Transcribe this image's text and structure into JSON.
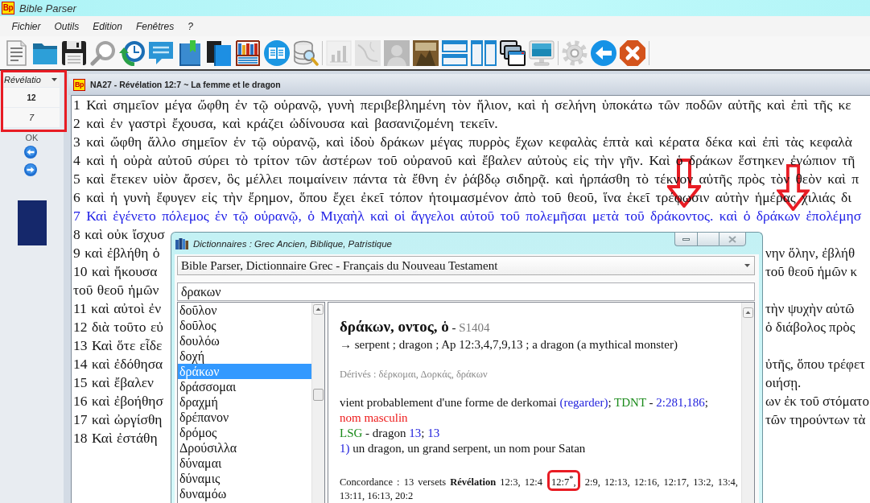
{
  "app": {
    "logo": "Bp",
    "title": "Bible Parser"
  },
  "menu": [
    "Fichier",
    "Outils",
    "Edition",
    "Fenêtres",
    "?"
  ],
  "toolbar": {
    "groups": [
      [
        {
          "disabled": false
        },
        {
          "disabled": false
        },
        {
          "disabled": false
        },
        {
          "disabled": false
        },
        {
          "disabled": false
        },
        {
          "disabled": false
        },
        {
          "disabled": false
        },
        {
          "disabled": false
        },
        {
          "disabled": false
        },
        {
          "disabled": false
        },
        {
          "disabled": false
        }
      ],
      [
        {
          "disabled": true
        },
        {
          "disabled": true
        },
        {
          "disabled": true
        },
        {
          "disabled": false
        },
        {
          "disabled": false
        },
        {
          "disabled": false
        },
        {
          "disabled": false
        },
        {
          "disabled": false
        }
      ],
      [
        {
          "disabled": false
        },
        {
          "disabled": false
        },
        {
          "disabled": false
        }
      ]
    ]
  },
  "navigator": {
    "book": "Révélatio",
    "chapter": "12",
    "verse": "7",
    "button": "OK"
  },
  "document": {
    "logo": "Bp",
    "title": "NA27 - Révélation 12:7 ~ La femme et le dragon",
    "lines": [
      {
        "kind": "full",
        "number": "1",
        "text": "Καὶ σημεῖον μέγα ὤφθη ἐν τῷ οὐρανῷ, γυνὴ περιβεβλημένη τὸν ἥλιον, καὶ ἡ σελήνη ὑποκάτω τῶν ποδῶν αὐτῆς καὶ ἐπὶ τῆς κε",
        "selected": false
      },
      {
        "kind": "full",
        "number": "2",
        "text": "καὶ ἐν γαστρὶ ἔχουσα, καὶ κράζει ὠδίνουσα καὶ βασανιζομένη τεκεῖν.",
        "selected": false
      },
      {
        "kind": "full",
        "number": "3",
        "text": "καὶ ὤφθη ἄλλο σημεῖον ἐν τῷ οὐρανῷ, καὶ ἰδοὺ δράκων μέγας πυρρὸς ἔχων κεφαλὰς ἑπτὰ καὶ κέρατα δέκα καὶ ἐπὶ τὰς κεφαλὰ",
        "selected": false
      },
      {
        "kind": "full",
        "number": "4",
        "text": "καὶ ἡ οὐρὰ αὐτοῦ σύρει τὸ τρίτον τῶν ἀστέρων τοῦ οὐρανοῦ καὶ ἔβαλεν αὐτοὺς εἰς τὴν γῆν. Καὶ ὁ δράκων ἕστηκεν ἐνώπιον τῆ",
        "selected": false
      },
      {
        "kind": "full",
        "number": "5",
        "text": "καὶ ἔτεκεν υἱὸν ἄρσεν, ὃς μέλλει ποιμαίνειν πάντα τὰ ἔθνη ἐν ῥάβδῳ σιδηρᾷ. καὶ ἡρπάσθη τὸ τέκνον αὐτῆς πρὸς τὸν θεὸν καὶ π",
        "selected": false
      },
      {
        "kind": "full",
        "number": "6",
        "text": "καὶ ἡ γυνὴ ἔφυγεν εἰς τὴν ἔρημον, ὅπου ἔχει ἐκεῖ τόπον ἡτοιμασμένον ἀπὸ τοῦ θεοῦ, ἵνα ἐκεῖ τρέφωσιν αὐτὴν ἡμέρας χιλιάς δι",
        "selected": false
      },
      {
        "kind": "full",
        "number": "7",
        "text": "Καὶ ἐγένετο πόλεμος ἐν τῷ οὐρανῷ, ὁ Μιχαὴλ καὶ οἱ ἄγγελοι αὐτοῦ τοῦ πολεμῆσαι μετὰ τοῦ δράκοντος. καὶ ὁ δράκων ἐπολέμησ",
        "selected": true
      },
      {
        "kind": "split",
        "number": "8",
        "left": "καὶ οὐκ ἴσχυσ",
        "selected": false
      },
      {
        "kind": "split",
        "number": "9",
        "left": "καὶ ἐβλήθη ὁ",
        "right": "νην ὅλην, ἐβλήθ",
        "selected": false
      },
      {
        "kind": "split",
        "number": "10",
        "left": "καὶ ἤκουσα",
        "right": "τοῦ θεοῦ ἡμῶν κ",
        "selected": false
      },
      {
        "kind": "split",
        "left": "τοῦ θεοῦ ἡμῶν",
        "selected": false
      },
      {
        "kind": "split",
        "number": "11",
        "left": "καὶ αὐτοὶ ἐν",
        "right": "τὴν ψυχὴν αὐτῶ",
        "selected": false
      },
      {
        "kind": "split",
        "number": "12",
        "left": "διὰ τοῦτο εὐ",
        "right": "ὁ διάβολος πρὸς",
        "selected": false
      },
      {
        "kind": "split",
        "number": "13",
        "left": "Καὶ ὅτε εἶδε",
        "selected": false
      },
      {
        "kind": "split",
        "number": "14",
        "left": "καὶ ἐδόθησα",
        "right": "ὐτῆς, ὅπου τρέφετ",
        "selected": false
      },
      {
        "kind": "split",
        "number": "15",
        "left": "καὶ ἔβαλεν",
        "right": "οιήσῃ.",
        "selected": false
      },
      {
        "kind": "split",
        "number": "16",
        "left": "καὶ ἐβοήθησ",
        "right": "ων ἐκ τοῦ στόματο",
        "selected": false
      },
      {
        "kind": "split",
        "number": "17",
        "left": "καὶ ὠργίσθη",
        "right": "τῶν τηρούντων τὰ",
        "selected": false
      },
      {
        "kind": "split",
        "number": "18",
        "left": "Καὶ ἐστάθη",
        "selected": false
      }
    ]
  },
  "dictionary": {
    "title": "Dictionnaires : Grec Ancien, Biblique, Patristique",
    "source": "Bible Parser, Dictionnaire Grec - Français du Nouveau Testament",
    "search": "δρακων",
    "entries": [
      {
        "label": "δοῦλον",
        "selected": false
      },
      {
        "label": "δοῦλος",
        "selected": false
      },
      {
        "label": "δουλόω",
        "selected": false
      },
      {
        "label": "δοχή",
        "selected": false
      },
      {
        "label": "δράκων",
        "selected": true
      },
      {
        "label": "δράσσομαι",
        "selected": false
      },
      {
        "label": "δραχμή",
        "selected": false
      },
      {
        "label": "δρέπανον",
        "selected": false
      },
      {
        "label": "δρόμος",
        "selected": false
      },
      {
        "label": "Δρούσιλλα",
        "selected": false
      },
      {
        "label": "δύναμαι",
        "selected": false
      },
      {
        "label": "δύναμις",
        "selected": false
      },
      {
        "label": "δυναμόω",
        "selected": false
      }
    ],
    "article": [
      {
        "kind": "heading",
        "segments": [
          {
            "kind": "lemma",
            "text": "δράκων, οντος, ὁ"
          },
          {
            "kind": "plain",
            "text": " - "
          },
          {
            "kind": "code",
            "text": "S1404"
          }
        ]
      },
      {
        "kind": "gloss",
        "segments": [
          {
            "kind": "plain",
            "text": "→ serpent ; dragon ; Ap 12:3,4,7,9,13 ; a dragon (a mythical monster)"
          }
        ]
      },
      {
        "kind": "derived",
        "segments": [
          {
            "kind": "plain",
            "text": "Dérivés : δέρκομαι, Δορκάς, δράκων"
          }
        ]
      },
      {
        "kind": "body",
        "segments": [
          {
            "kind": "plain",
            "text": "vient probablement d'une forme de derkomai "
          },
          {
            "kind": "link",
            "text": "(regarder)"
          },
          {
            "kind": "plain",
            "text": "; "
          },
          {
            "kind": "label",
            "text": "TDNT"
          },
          {
            "kind": "plain",
            "text": " - "
          },
          {
            "kind": "link",
            "text": "2:281,186"
          },
          {
            "kind": "plain",
            "text": ";"
          }
        ]
      },
      {
        "kind": "body",
        "segments": [
          {
            "kind": "grammar",
            "text": "nom masculin"
          }
        ]
      },
      {
        "kind": "body",
        "segments": [
          {
            "kind": "label",
            "text": "LSG"
          },
          {
            "kind": "plain",
            "text": " - dragon "
          },
          {
            "kind": "link",
            "text": "13"
          },
          {
            "kind": "plain",
            "text": "; "
          },
          {
            "kind": "link",
            "text": "13"
          }
        ]
      },
      {
        "kind": "body",
        "segments": [
          {
            "kind": "link",
            "text": "1)"
          },
          {
            "kind": "plain",
            "text": " un dragon, un grand serpent, un nom pour Satan"
          }
        ]
      },
      {
        "kind": "concordance",
        "segments": [
          {
            "kind": "plain",
            "text": "Concordance : 13 versets "
          },
          {
            "kind": "bold",
            "text": "Révélation"
          },
          {
            "kind": "plain",
            "text": " 12:3, 12:4 "
          },
          {
            "kind": "marked",
            "text": "12:7$^{*}$,"
          },
          {
            "kind": "plain",
            "text": " 2:9, 12:13, 12:16, 12:17, 13:2, 13:4, 13:11, 16:13, 20:2"
          }
        ]
      }
    ]
  }
}
